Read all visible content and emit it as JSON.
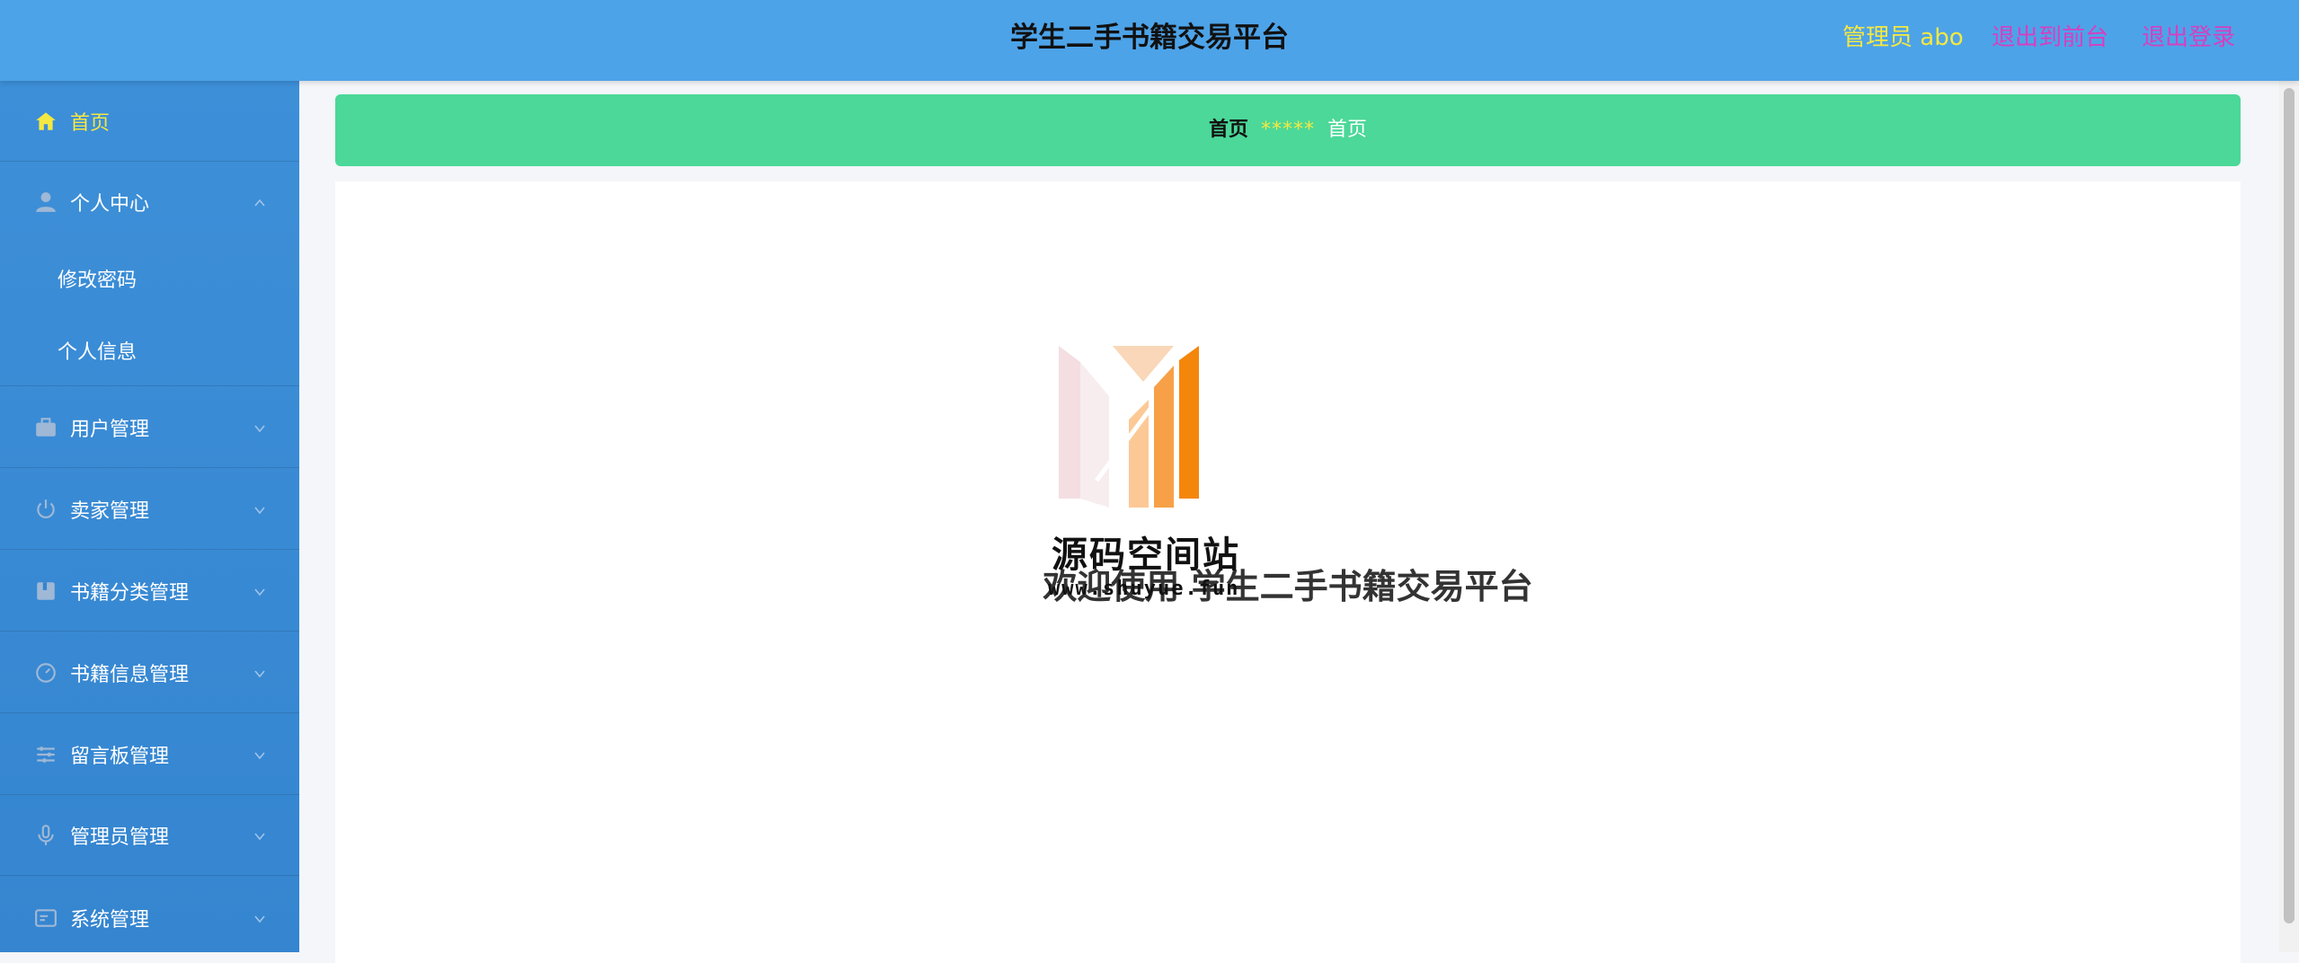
{
  "header": {
    "title": "学生二手书籍交易平台",
    "admin_label": "管理员 abo",
    "back_to_front": "退出到前台",
    "logout": "退出登录"
  },
  "sidebar": {
    "items": [
      {
        "label": "首页",
        "icon": "home-icon"
      },
      {
        "label": "个人中心",
        "icon": "user-icon",
        "sub": [
          "修改密码",
          "个人信息"
        ]
      },
      {
        "label": "用户管理",
        "icon": "briefcase-icon"
      },
      {
        "label": "卖家管理",
        "icon": "power-icon"
      },
      {
        "label": "书籍分类管理",
        "icon": "book-icon"
      },
      {
        "label": "书籍信息管理",
        "icon": "dashboard-icon"
      },
      {
        "label": "留言板管理",
        "icon": "sliders-icon"
      },
      {
        "label": "管理员管理",
        "icon": "microphone-icon"
      },
      {
        "label": "系统管理",
        "icon": "system-icon"
      }
    ]
  },
  "breadcrumb": {
    "first": "首页",
    "separator": "*****",
    "second": "首页"
  },
  "content": {
    "welcome": "欢迎使用 学生二手书籍交易平台"
  },
  "watermark": {
    "text": "源码空间站",
    "url": "www.shuyue.fun"
  },
  "colors": {
    "header_bg": "#4da3e8",
    "sidebar_bg": "#3585d0",
    "active_text": "#f4e842",
    "link_text": "#d63fc0",
    "breadcrumb_bg": "#4bd898"
  }
}
